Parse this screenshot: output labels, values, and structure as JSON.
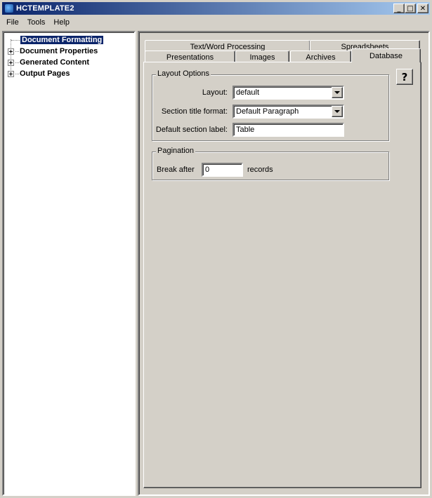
{
  "window": {
    "title": "HCTEMPLATE2",
    "controls": {
      "minimize": "_",
      "maximize": "□",
      "close": "✕"
    }
  },
  "menu": [
    "File",
    "Tools",
    "Help"
  ],
  "tree": {
    "items": [
      {
        "label": "Document Formatting",
        "selected": true,
        "expandable": false
      },
      {
        "label": "Document Properties",
        "selected": false,
        "expandable": true
      },
      {
        "label": "Generated Content",
        "selected": false,
        "expandable": true
      },
      {
        "label": "Output Pages",
        "selected": false,
        "expandable": true
      }
    ]
  },
  "tabs": {
    "row_back": [
      "Text/Word Processing",
      "Spreadsheets"
    ],
    "row_front": [
      "Presentations",
      "Images",
      "Archives",
      "Database"
    ],
    "active": "Database"
  },
  "help_button": {
    "label": "?"
  },
  "layout_options": {
    "title": "Layout Options",
    "layout_label": "Layout:",
    "layout_value": "default",
    "section_title_format_label": "Section title format:",
    "section_title_format_value": "Default Paragraph",
    "default_section_label_label": "Default section label:",
    "default_section_label_value": "Table"
  },
  "pagination": {
    "title": "Pagination",
    "break_after_label": "Break after",
    "break_after_value": "0",
    "records_label": "records"
  }
}
